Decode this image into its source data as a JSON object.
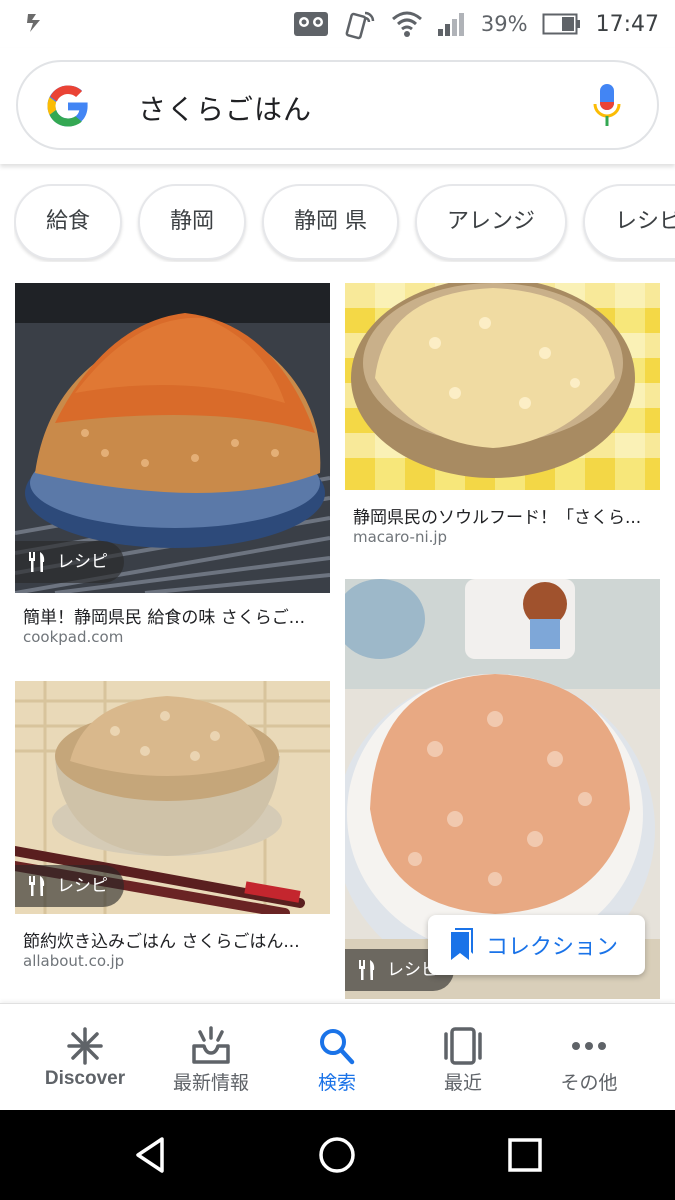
{
  "status_bar": {
    "battery_percent": "39%",
    "time": "17:47"
  },
  "search": {
    "query": "さくらごはん"
  },
  "chips": [
    "給食",
    "静岡",
    "静岡 県",
    "アレンジ",
    "レシピ"
  ],
  "results": [
    {
      "badge": "レシピ",
      "title": "簡単！静岡県民 給食の味 さくらご...",
      "source": "cookpad.com"
    },
    {
      "badge": "",
      "title": "静岡県民のソウルフード！「さくら...",
      "source": "macaro-ni.jp"
    },
    {
      "badge": "レシピ",
      "title": "節約炊き込みごはん さくらごはん...",
      "source": "allabout.co.jp"
    },
    {
      "badge": "レシピ",
      "title": "",
      "source": ""
    }
  ],
  "collection_button": {
    "label": "コレクション"
  },
  "bottom_nav": [
    {
      "label": "Discover",
      "icon": "asterisk-icon"
    },
    {
      "label": "最新情報",
      "icon": "inbox-updates-icon"
    },
    {
      "label": "検索",
      "icon": "search-icon",
      "active": true
    },
    {
      "label": "最近",
      "icon": "recent-tabs-icon"
    },
    {
      "label": "その他",
      "icon": "more-dots-icon"
    }
  ],
  "colors": {
    "accent": "#1a73e8",
    "google_blue": "#4285f4",
    "google_red": "#ea4335",
    "google_yellow": "#fbbc05",
    "google_green": "#34a853"
  }
}
